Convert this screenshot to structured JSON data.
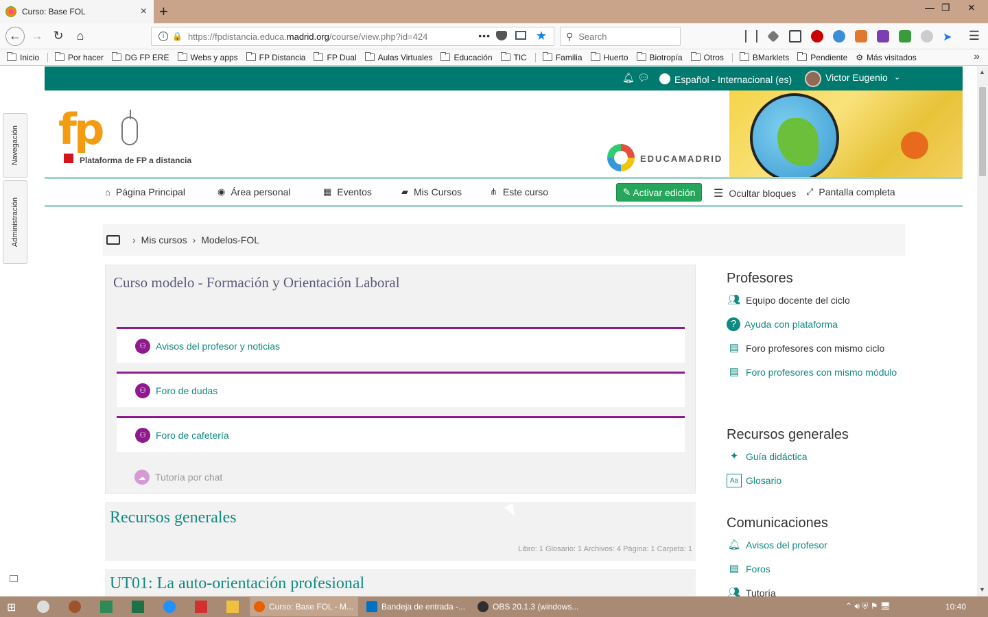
{
  "browser": {
    "tab_title": "Curso: Base FOL",
    "tab_close": "×",
    "new_tab": "+",
    "window_minimize": "—",
    "window_restore": "❐",
    "window_close": "✕",
    "url_prefix": "https://fpdistancia.educa.",
    "url_domain": "madrid.org",
    "url_path": "/course/view.php?id=424",
    "url_dots": "•••",
    "search_placeholder": "Search",
    "menu_icon": "☰",
    "bookmarks_more": "»"
  },
  "bookmarks": [
    {
      "label": "Inicio"
    },
    {
      "label": "Por hacer"
    },
    {
      "label": "DG FP ERE"
    },
    {
      "label": "Webs y apps"
    },
    {
      "label": "FP Distancia"
    },
    {
      "label": "FP Dual"
    },
    {
      "label": "Aulas Virtuales"
    },
    {
      "label": "Educación"
    },
    {
      "label": "TIC"
    },
    {
      "label": "Familia"
    },
    {
      "label": "Huerto"
    },
    {
      "label": "Biotropía"
    },
    {
      "label": "Otros"
    },
    {
      "label": "BMarklets"
    },
    {
      "label": "Pendiente"
    },
    {
      "label": "Más visitados"
    }
  ],
  "side_tabs": {
    "navigation": "Navegación",
    "administration": "Administración"
  },
  "topbar": {
    "language": "Español - Internacional (es)",
    "user_name": "Victor Eugenio"
  },
  "header": {
    "logo_fp": "fp",
    "logo_subtitle": "Plataforma de FP a distancia",
    "educamadrid": "EDUCAMADRID"
  },
  "mainnav": {
    "home": "Página Principal",
    "personal": "Área personal",
    "events": "Eventos",
    "my_courses": "Mis Cursos",
    "this_course": "Este curso",
    "edit": "Activar edición",
    "hide_blocks": "Ocultar bloques",
    "fullscreen": "Pantalla completa"
  },
  "breadcrumb": {
    "items": [
      "Mis cursos",
      "Modelos-FOL"
    ]
  },
  "section0": {
    "title": "Curso modelo - Formación y Orientación Laboral",
    "activities": [
      "Avisos del profesor y noticias",
      "Foro de dudas",
      "Foro de cafetería"
    ],
    "chat": "Tutoría por chat"
  },
  "section1": {
    "title": "Recursos generales",
    "summary": "Libro: 1  Glosario: 1  Archivos: 4  Página: 1  Carpeta: 1"
  },
  "section2": {
    "title": "UT01: La auto-orientación profesional"
  },
  "blocks": {
    "profesores": {
      "title": "Profesores",
      "items": [
        "Equipo docente del ciclo",
        "Ayuda con plataforma",
        "Foro profesores con mismo ciclo",
        "Foro profesores con mismo módulo"
      ]
    },
    "recursos": {
      "title": "Recursos generales",
      "items": [
        "Guía didáctica",
        "Glosario"
      ]
    },
    "comunicaciones": {
      "title": "Comunicaciones",
      "items": [
        "Avisos del profesor",
        "Foros",
        "Tutoría"
      ]
    }
  },
  "taskbar": {
    "tasks": [
      "Curso: Base FOL - M...",
      "Bandeja de entrada -...",
      "OBS 20.1.3 (windows..."
    ],
    "clock": "10:40"
  },
  "colors": {
    "moodle_teal": "#007a6e",
    "link_teal": "#0f8a80",
    "forum_purple": "#8e1a8e",
    "edit_green": "#26a65b"
  }
}
